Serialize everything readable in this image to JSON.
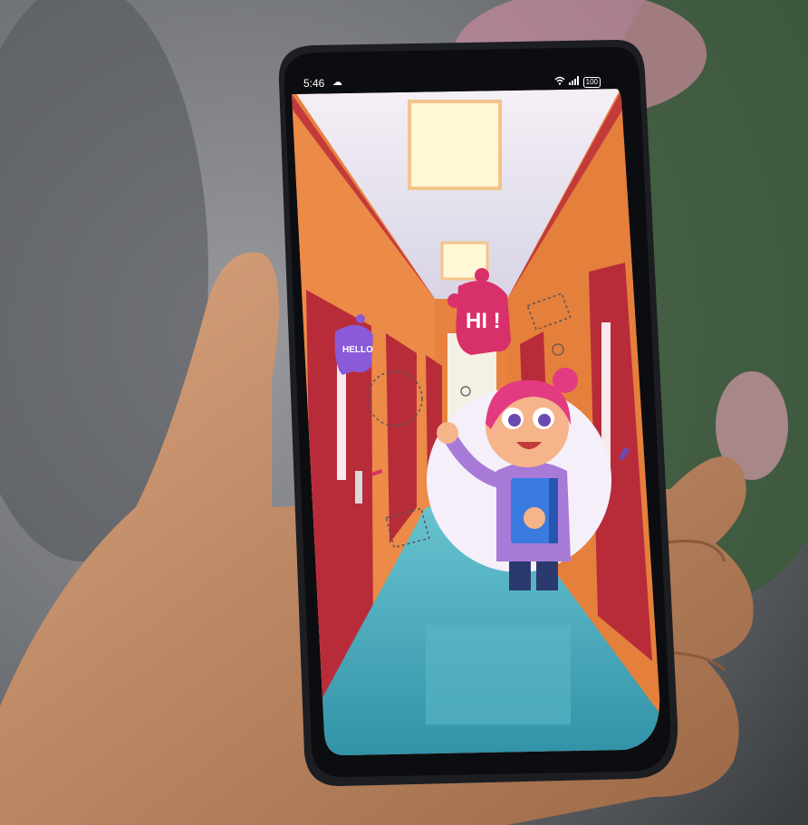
{
  "status_bar": {
    "time": "5:46",
    "cloud_icon": "cloud-icon",
    "wifi_icon": "wifi-icon",
    "signal_icon": "signal-icon",
    "battery": "100"
  },
  "illustration": {
    "hello_bubble": "HELLO",
    "hi_bubble": "HI !"
  },
  "colors": {
    "wall": "#e8823f",
    "door": "#b82c3a",
    "floor": "#3fa6b8",
    "bubble_pink": "#d8306a",
    "bubble_purple": "#8a5ad8",
    "shirt": "#a77ad8"
  }
}
